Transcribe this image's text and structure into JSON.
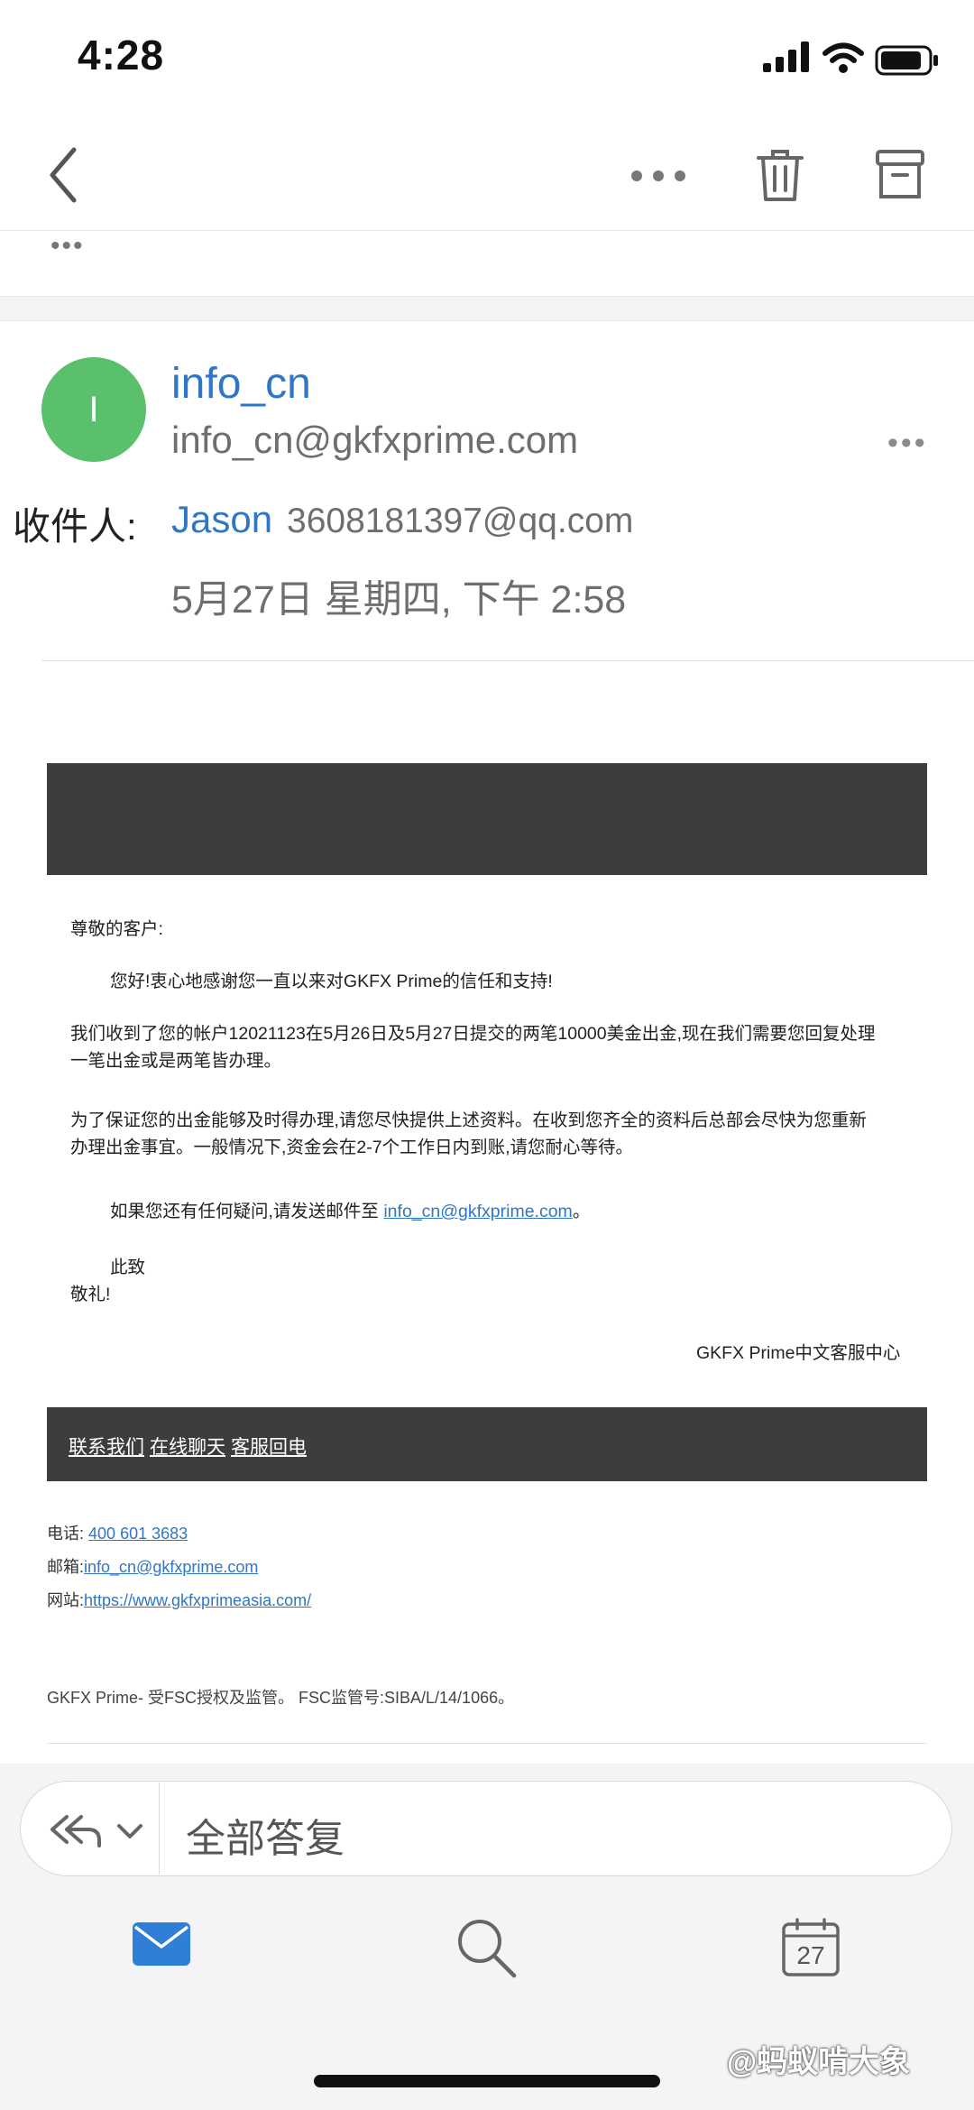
{
  "status_bar": {
    "time": "4:28"
  },
  "email": {
    "sender_initial": "I",
    "sender_name": "info_cn",
    "sender_email": "info_cn@gkfxprime.com",
    "to_label": "收件人:",
    "to_name": "Jason",
    "to_email": "3608181397@qq.com",
    "date": "5月27日 星期四, 下午 2:58"
  },
  "body": {
    "greeting": "尊敬的客户:",
    "p1": "您好!衷心地感谢您一直以来对GKFX Prime的信任和支持!",
    "p2_line1": "我们收到了您的帐户12021123在5月26日及5月27日提交的两笔10000美金出金,现在我们需要您回复处理",
    "p2_line2": "一笔出金或是两笔皆办理。",
    "p3_line1": "为了保证您的出金能够及时得办理,请您尽快提供上述资料。在收到您齐全的资料后总部会尽快为您重新",
    "p3_line2": "办理出金事宜。一般情况下,资金会在2-7个工作日内到账,请您耐心等待。",
    "p4_prefix": "如果您还有任何疑问,请发送邮件至 ",
    "p4_link": "info_cn@gkfxprime.com",
    "p4_suffix": "。",
    "closing1": "此致",
    "closing2": "敬礼!",
    "signature": "GKFX Prime中文客服中心",
    "footer_links": [
      "联系我们",
      "在线聊天",
      "客服回电"
    ],
    "phone_label": "电话:",
    "phone": "400 601 3683",
    "mail_label": "邮箱:",
    "mail": "info_cn@gkfxprime.com",
    "web_label": "网站:",
    "web": "https://www.gkfxprimeasia.com/",
    "legal": "GKFX Prime- 受FSC授权及监管。 FSC监管号:SIBA/L/14/1066。"
  },
  "reply_bar": {
    "label": "全部答复"
  },
  "tab_bar": {
    "calendar_day": "27"
  },
  "watermark": "@蚂蚁啃大象",
  "colors": {
    "link": "#2f76c6",
    "avatar": "#5bc06b",
    "banner": "#3d3d3d"
  }
}
